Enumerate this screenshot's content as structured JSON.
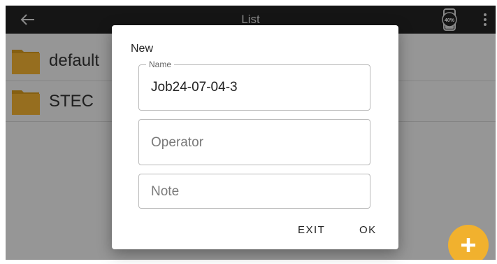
{
  "appbar": {
    "title": "List",
    "battery_text": "40%"
  },
  "list": {
    "items": [
      {
        "label": "default"
      },
      {
        "label": "STEC"
      }
    ]
  },
  "dialog": {
    "title": "New",
    "name_field": {
      "label": "Name",
      "value": "Job24-07-04-3"
    },
    "operator_field": {
      "placeholder": "Operator"
    },
    "note_field": {
      "placeholder": "Note"
    },
    "exit_label": "EXIT",
    "ok_label": "OK"
  },
  "colors": {
    "folder": "#f2b232",
    "fab": "#f1b12e",
    "appbar": "#222222"
  }
}
